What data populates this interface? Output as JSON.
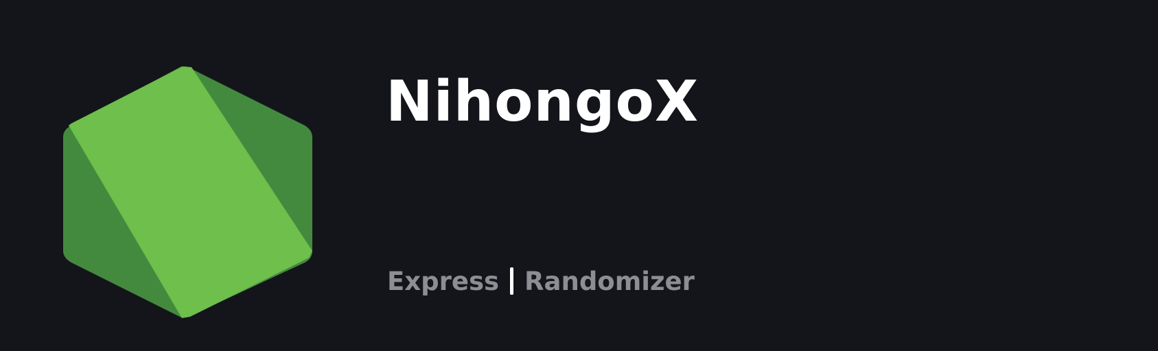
{
  "title": "NihongoX",
  "tags": {
    "left": "Express",
    "separator_icon": "vertical-bar",
    "right": "Randomizer"
  },
  "logo": {
    "icon": "hexagon-logo-icon",
    "colors": {
      "light": "#6ebf4b",
      "dark": "#438a3e"
    }
  },
  "colors": {
    "background": "#14151a",
    "title": "#ffffff",
    "subtitle": "#8d8e93",
    "separator": "#ffffff"
  }
}
